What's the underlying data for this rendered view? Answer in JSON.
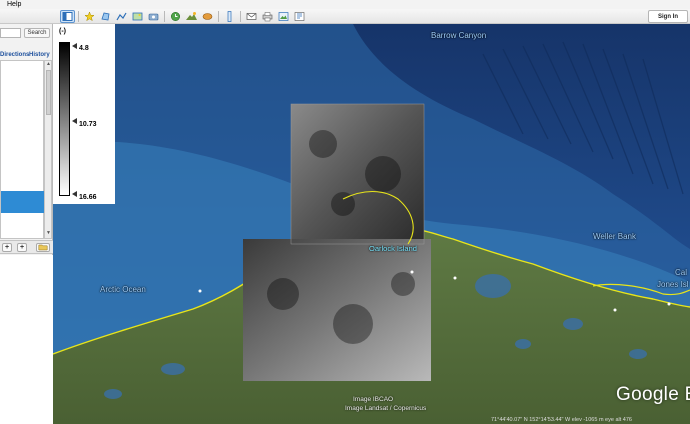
{
  "menu": {
    "help": "Help"
  },
  "toolbar": {
    "sign_in": "Sign In",
    "buttons": [
      "sidebar-toggle-icon",
      "placemark-icon",
      "polygon-icon",
      "path-icon",
      "overlay-icon",
      "tour-icon",
      "historical-imagery-icon",
      "sunlight-icon",
      "planet-icon",
      "ruler-icon",
      "email-icon",
      "print-icon",
      "save-image-icon",
      "view-in-maps-icon"
    ]
  },
  "sidebar": {
    "search_placeholder": "",
    "search_button": "Search",
    "tabs": {
      "directions": "Directions",
      "history": "History"
    }
  },
  "legend": {
    "unit": "(-)",
    "min": "4.8",
    "mid": "10.73",
    "max": "16.66"
  },
  "map": {
    "labels": {
      "barrow_canyon": "Barrow Canyon",
      "walker_bank": "Weller Bank",
      "arctic_ocean": "Arctic Ocean",
      "oarlock_island": "Oarlock Island",
      "jones_islands": "Jones Isl",
      "edge_label": "Cal"
    },
    "credits": {
      "ibcao": "Image IBCAO",
      "landsat": "Image Landsat / Copernicus"
    },
    "logo": "Google E",
    "status": "71°44'40.07\" N  152°14'53.44\" W  elev -1065 m     eye alt 476"
  },
  "colors": {
    "coastline": "#e8e51a",
    "ocean": "#1c3f78",
    "land": "#4f6b3a",
    "selected": "#2e8bd4"
  }
}
